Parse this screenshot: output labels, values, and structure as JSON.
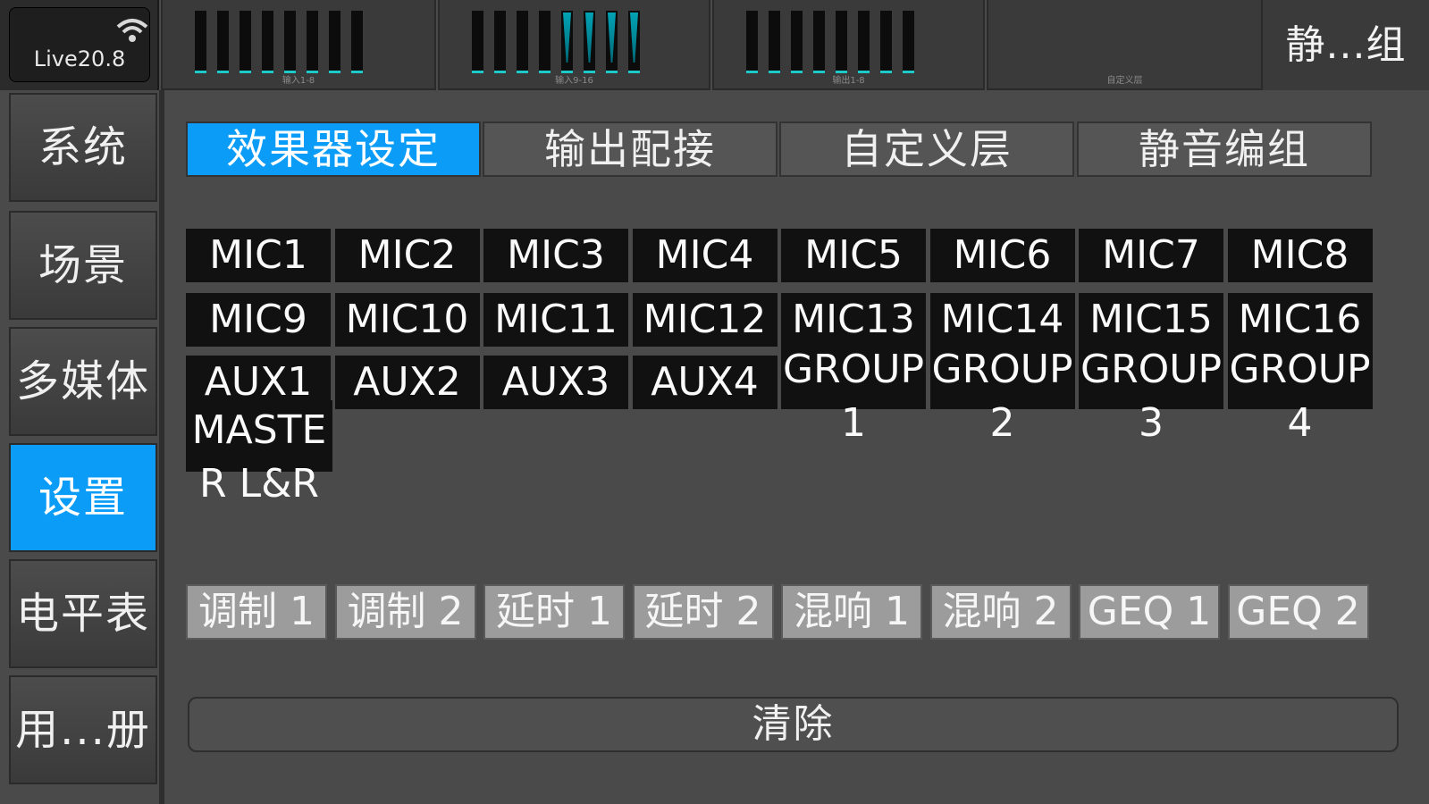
{
  "device": {
    "name": "Live20.8",
    "icon": "wifi-icon"
  },
  "meters": [
    {
      "label": "输入1-8",
      "bars": 8,
      "active": []
    },
    {
      "label": "输入9-16",
      "bars": 8,
      "active": [
        4,
        5,
        6,
        7
      ]
    },
    {
      "label": "输出1-8",
      "bars": 8,
      "active": []
    },
    {
      "label": "自定义层",
      "bars": 0,
      "active": []
    }
  ],
  "top_right": {
    "label": "静...组"
  },
  "nav": [
    "系统",
    "场景",
    "多媒体",
    "设置",
    "电平表",
    "用...册"
  ],
  "nav_active_index": 3,
  "tabs": [
    "效果器设定",
    "输出配接",
    "自定义层",
    "静音编组"
  ],
  "tab_active_index": 0,
  "channels": [
    [
      "MIC1",
      "MIC2",
      "MIC3",
      "MIC4",
      "MIC5",
      "MIC6",
      "MIC7",
      "MIC8"
    ],
    [
      "MIC9",
      "MIC10",
      "MIC11",
      "MIC12",
      "MIC13",
      "MIC14",
      "MIC15",
      "MIC16"
    ],
    [
      "AUX1",
      "AUX2",
      "AUX3",
      "AUX4",
      "GROUP1",
      "GROUP2",
      "GROUP3",
      "GROUP4"
    ],
    [
      "MASTER L&R"
    ]
  ],
  "effects": [
    "调制 1",
    "调制 2",
    "延时 1",
    "延时 2",
    "混响 1",
    "混响 2",
    "GEQ 1",
    "GEQ 2"
  ],
  "clear_label": "清除",
  "colors": {
    "accent": "#0a9cf7",
    "meter": "#1ec9c9",
    "effect_bg": "#9c9c9c"
  }
}
